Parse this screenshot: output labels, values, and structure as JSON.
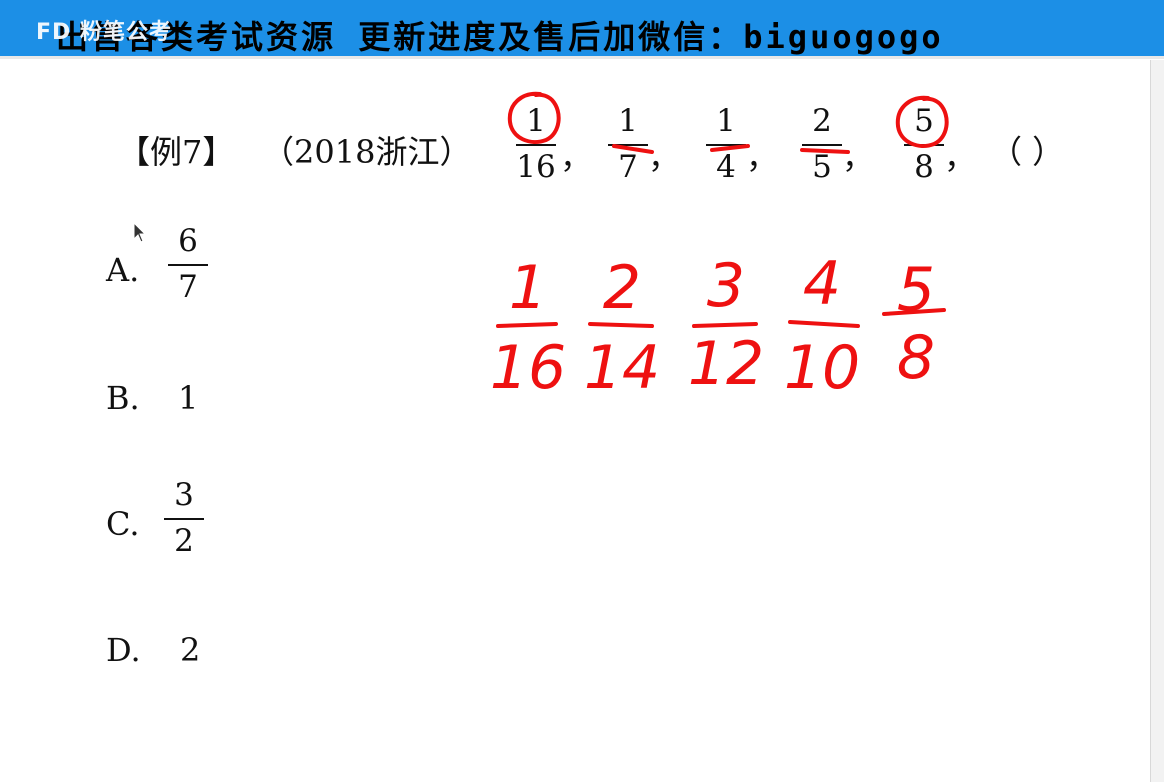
{
  "banner": {
    "logo": "FD 粉笔公考",
    "text": "出售各类考试资源 更新进度及售后加微信：biguogogo"
  },
  "question": {
    "tag": "【例7】",
    "source": "（2018浙江）",
    "sequence": [
      {
        "num": "1",
        "den": "16"
      },
      {
        "num": "1",
        "den": "7"
      },
      {
        "num": "1",
        "den": "4"
      },
      {
        "num": "2",
        "den": "5"
      },
      {
        "num": "5",
        "den": "8"
      }
    ],
    "separator": "，",
    "blank": "（    ）"
  },
  "options": [
    {
      "letter": "A.",
      "num": "6",
      "den": "7"
    },
    {
      "letter": "B.",
      "value": "1"
    },
    {
      "letter": "C.",
      "num": "3",
      "den": "2"
    },
    {
      "letter": "D.",
      "value": "2"
    }
  ],
  "annotation": {
    "ink_color": "#ee1111",
    "rewritten": [
      {
        "num": "1",
        "den": "16"
      },
      {
        "num": "2",
        "den": "14"
      },
      {
        "num": "3",
        "den": "12"
      },
      {
        "num": "4",
        "den": "10"
      },
      {
        "num": "5",
        "den": "8"
      }
    ]
  }
}
